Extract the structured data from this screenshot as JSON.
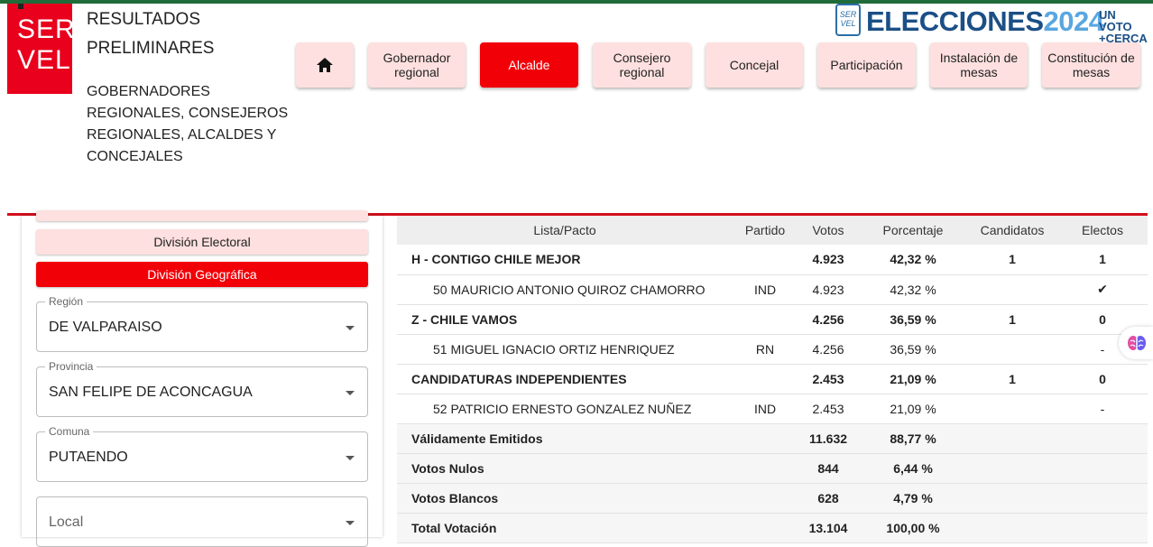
{
  "header": {
    "logo_line1": "SER",
    "logo_line2": "VEL",
    "title_line1": "RESULTADOS",
    "title_line2": "PRELIMINARES",
    "subtitle": "GOBERNADORES REGIONALES, CONSEJEROS REGIONALES, ALCALDES Y CONCEJALES",
    "brand": {
      "seal_line1": "SER",
      "seal_line2": "VEL",
      "elecciones": "ELECCIONES",
      "year": "2024",
      "tag_line1": "UN VOTO",
      "tag_line2": "+CERCA"
    }
  },
  "nav": {
    "home_icon": "home-icon",
    "items": [
      {
        "label": "Gobernador regional"
      },
      {
        "label": "Alcalde",
        "active": true
      },
      {
        "label": "Consejero regional"
      },
      {
        "label": "Concejal"
      },
      {
        "label": "Participación"
      },
      {
        "label": "Instalación de mesas"
      },
      {
        "label": "Constitución de mesas"
      }
    ]
  },
  "sidebar": {
    "division_electoral": "División Electoral",
    "division_geografica": "División Geográfica",
    "region": {
      "label": "Región",
      "value": "DE VALPARAISO"
    },
    "provincia": {
      "label": "Provincia",
      "value": "SAN FELIPE DE ACONCAGUA"
    },
    "comuna": {
      "label": "Comuna",
      "value": "PUTAENDO"
    },
    "local": {
      "placeholder": "Local"
    }
  },
  "results": {
    "headers": [
      "Lista/Pacto",
      "Partido",
      "Votos",
      "Porcentaje",
      "Candidatos",
      "Electos"
    ],
    "rows": [
      {
        "name": "H - CONTIGO CHILE MEJOR",
        "partido": "",
        "votos": "4.923",
        "porcentaje": "42,32 %",
        "candidatos": "1",
        "electos": "1"
      },
      {
        "name": "50 MAURICIO ANTONIO QUIROZ CHAMORRO",
        "partido": "IND",
        "votos": "4.923",
        "porcentaje": "42,32 %",
        "candidatos": "",
        "electos": "✔"
      },
      {
        "name": "Z - CHILE VAMOS",
        "partido": "",
        "votos": "4.256",
        "porcentaje": "36,59 %",
        "candidatos": "1",
        "electos": "0"
      },
      {
        "name": "51 MIGUEL IGNACIO ORTIZ HENRIQUEZ",
        "partido": "RN",
        "votos": "4.256",
        "porcentaje": "36,59 %",
        "candidatos": "",
        "electos": "-"
      },
      {
        "name": "CANDIDATURAS INDEPENDIENTES",
        "partido": "",
        "votos": "2.453",
        "porcentaje": "21,09 %",
        "candidatos": "1",
        "electos": "0"
      },
      {
        "name": "52 PATRICIO ERNESTO GONZALEZ NUÑEZ",
        "partido": "IND",
        "votos": "2.453",
        "porcentaje": "21,09 %",
        "candidatos": "",
        "electos": "-"
      },
      {
        "name": "Válidamente Emitidos",
        "partido": "",
        "votos": "11.632",
        "porcentaje": "88,77 %",
        "candidatos": "",
        "electos": ""
      },
      {
        "name": "Votos Nulos",
        "partido": "",
        "votos": "844",
        "porcentaje": "6,44 %",
        "candidatos": "",
        "electos": ""
      },
      {
        "name": "Votos Blancos",
        "partido": "",
        "votos": "628",
        "porcentaje": "4,79 %",
        "candidatos": "",
        "electos": ""
      },
      {
        "name": "Total Votación",
        "partido": "",
        "votos": "13.104",
        "porcentaje": "100,00 %",
        "candidatos": "",
        "electos": ""
      }
    ]
  },
  "colors": {
    "accent_red": "#f20008",
    "pill_pink": "#fde0df",
    "brand_blue": "#1b4f86",
    "brand_light_blue": "#5aa6e0",
    "top_green": "#1f6b3a"
  }
}
